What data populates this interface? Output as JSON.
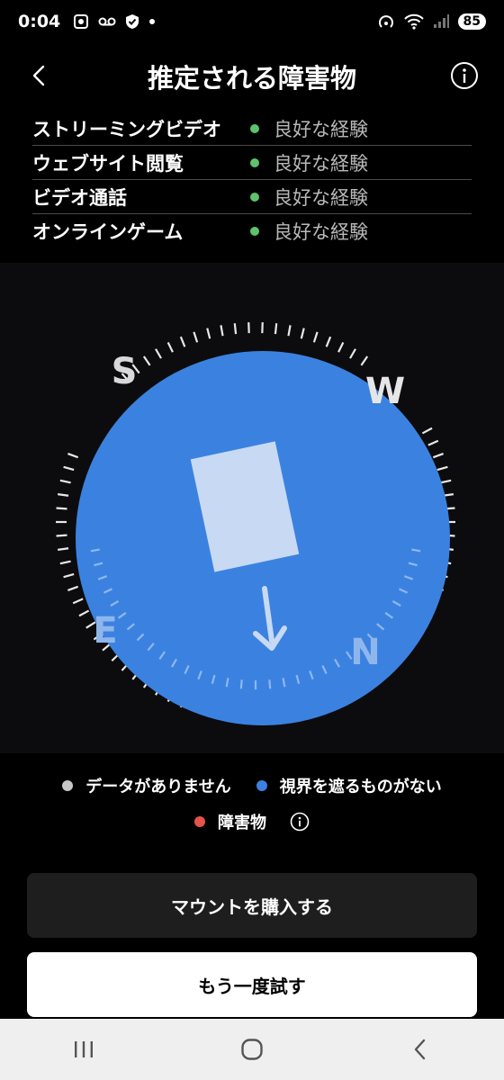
{
  "status_bar": {
    "time": "0:04",
    "battery": "85"
  },
  "header": {
    "title": "推定される障害物"
  },
  "experiences": [
    {
      "name": "ストリーミングビデオ",
      "status": "良好な経験"
    },
    {
      "name": "ウェブサイト閲覧",
      "status": "良好な経験"
    },
    {
      "name": "ビデオ通話",
      "status": "良好な経験"
    },
    {
      "name": "オンラインゲーム",
      "status": "良好な経験"
    }
  ],
  "compass": {
    "directions": {
      "s": "S",
      "w": "W",
      "e": "E",
      "n": "N"
    }
  },
  "legend": {
    "no_data": "データがありません",
    "clear": "視界を遮るものがない",
    "obstacle": "障害物"
  },
  "colors": {
    "good_dot": "#5ec26a",
    "no_data_dot": "#c8c8c8",
    "clear_dot": "#3b82e0",
    "obstacle_dot": "#e5534b",
    "compass_blue": "#3b82e0"
  },
  "buttons": {
    "buy_mount": "マウントを購入する",
    "retry": "もう一度試す"
  }
}
